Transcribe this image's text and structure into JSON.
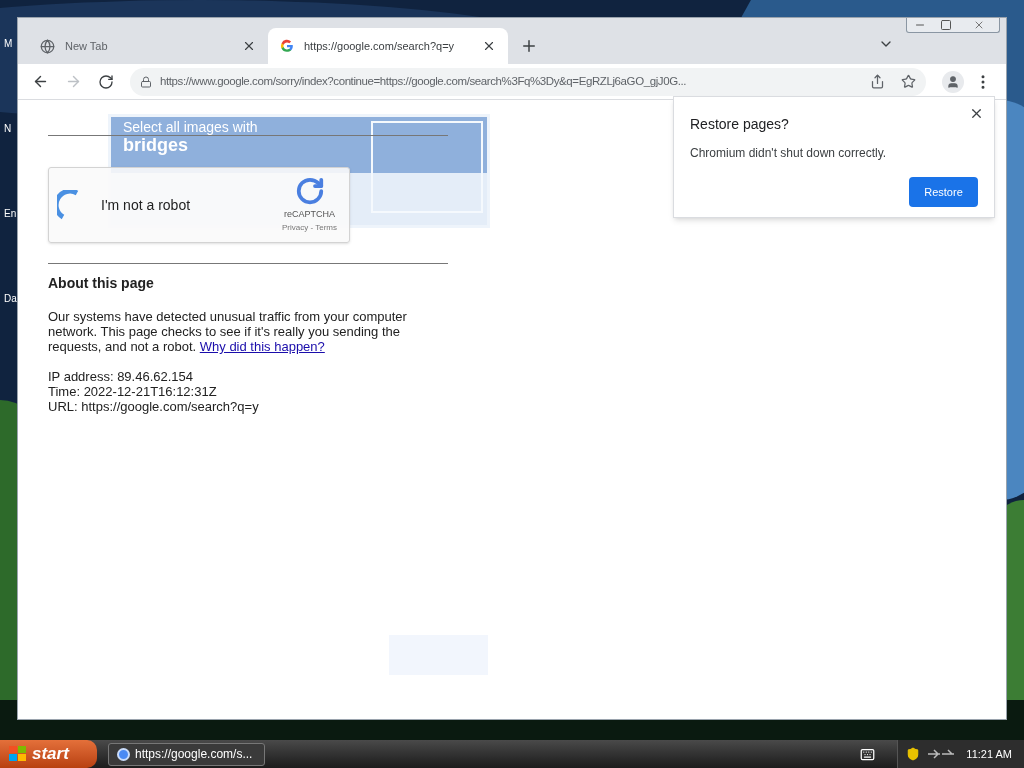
{
  "desktop": {
    "icon_labels": [
      "M",
      "N",
      "En",
      "Da"
    ]
  },
  "browser": {
    "tabs": [
      {
        "title": "New Tab",
        "selected": false
      },
      {
        "title": "https://google.com/search?q=y",
        "selected": true
      }
    ],
    "address": "https://www.google.com/sorry/index?continue=https://google.com/search%3Fq%3Dy&q=EgRZLj6aGO_gjJ0G...",
    "forward_disabled": true
  },
  "page": {
    "challenge": {
      "prompt": "Select all images with",
      "target": "bridges"
    },
    "captcha": {
      "label": "I'm not a robot",
      "brand": "reCAPTCHA",
      "links": "Privacy - Terms"
    },
    "about_heading": "About this page",
    "paragraph": "Our systems have detected unusual traffic from your computer network. This page checks to see if it's really you sending the requests, and not a robot.",
    "link": "Why did this happen?",
    "details": [
      "IP address: 89.46.62.154",
      "Time: 2022-12-21T16:12:31Z",
      "URL: https://google.com/search?q=y"
    ]
  },
  "restore_bubble": {
    "title": "Restore pages?",
    "message": "Chromium didn't shut down correctly.",
    "button": "Restore"
  },
  "taskbar": {
    "start": "start",
    "tasks": [
      {
        "title": "https://google.com/s...",
        "selected": false
      }
    ],
    "clock": "11:21 AM"
  }
}
